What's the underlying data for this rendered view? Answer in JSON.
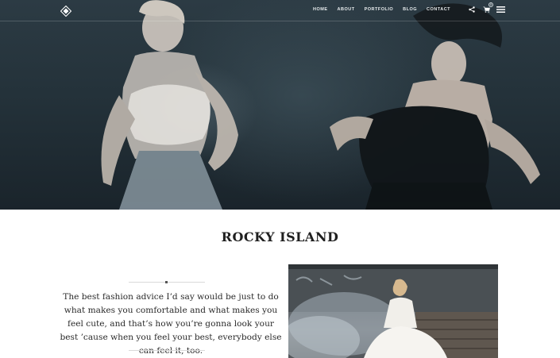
{
  "nav": {
    "items": [
      "HOME",
      "ABOUT",
      "PORTFOLIO",
      "BLOG",
      "CONTACT"
    ],
    "cart_count": "0"
  },
  "icons": {
    "logo": "diamond-logo-icon",
    "share": "share-icon",
    "cart": "cart-icon",
    "menu": "hamburger-menu-icon"
  },
  "section": {
    "title": "ROCKY ISLAND",
    "quote": "The best fashion advice I’d say would be just to do what makes you comfortable and what makes you feel cute, and that’s how you’re gonna look your best ’cause when you feel your best, everybody else can feel it, too."
  },
  "colors": {
    "hero_bg": "#24323a",
    "title": "#1f1f1f",
    "text": "#2a2a2a",
    "divider": "#d9d9d9"
  }
}
